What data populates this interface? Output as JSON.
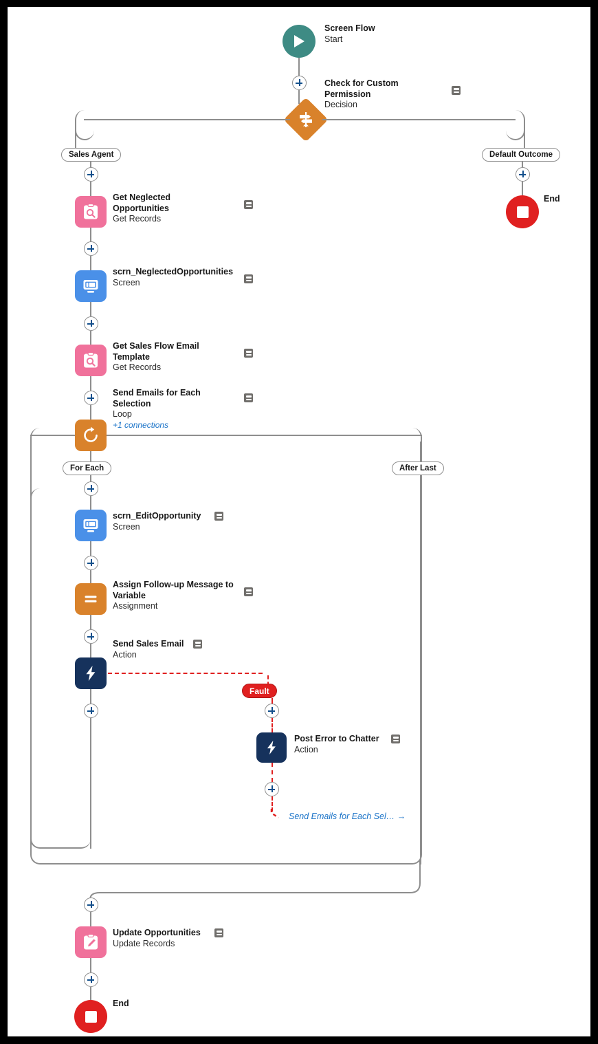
{
  "flow": {
    "start": {
      "title": "Screen Flow",
      "subtitle": "Start",
      "icon": "play-icon"
    },
    "nodes": [
      {
        "id": "decision",
        "title": "Check for Custom Permission",
        "subtitle": "Decision",
        "icon": "signpost-icon"
      },
      {
        "id": "getneg",
        "title": "Get Neglected Opportunities",
        "subtitle": "Get Records",
        "icon": "clipboard-search-icon"
      },
      {
        "id": "scrnneg",
        "title": "scrn_NeglectedOpportunities",
        "subtitle": "Screen",
        "icon": "monitor-icon"
      },
      {
        "id": "gettmpl",
        "title": "Get Sales Flow Email Template",
        "subtitle": "Get Records",
        "icon": "clipboard-search-icon"
      },
      {
        "id": "loop",
        "title": "Send Emails for Each Selection",
        "subtitle": "Loop",
        "icon": "refresh-icon",
        "connections": "+1 connections"
      },
      {
        "id": "scrnedit",
        "title": "scrn_EditOpportunity",
        "subtitle": "Screen",
        "icon": "monitor-icon"
      },
      {
        "id": "assign",
        "title": "Assign Follow-up Message to Variable",
        "subtitle": "Assignment",
        "icon": "equals-icon"
      },
      {
        "id": "sendemail",
        "title": "Send Sales Email",
        "subtitle": "Action",
        "icon": "lightning-icon"
      },
      {
        "id": "posterror",
        "title": "Post Error to Chatter",
        "subtitle": "Action",
        "icon": "lightning-icon"
      },
      {
        "id": "updateopps",
        "title": "Update Opportunities",
        "subtitle": "Update Records",
        "icon": "clipboard-pencil-icon"
      }
    ],
    "branch_labels": {
      "sales_agent": "Sales Agent",
      "default_outcome": "Default Outcome",
      "for_each": "For Each",
      "after_last": "After Last",
      "fault": "Fault"
    },
    "ends": {
      "right_end": "End",
      "bottom_end": "End"
    },
    "goto": {
      "label": "Send Emails for Each Sel…",
      "arrow": "→"
    },
    "colors": {
      "start": "#3E8B84",
      "end": "#E02020",
      "get_records": "#F0719B",
      "screen": "#4A90E8",
      "decision": "#D9822B",
      "loop": "#D9822B",
      "assignment": "#D9822B",
      "action": "#16325C",
      "fault": "#E02020",
      "connector": "#8E8E8E",
      "link": "#1A73C8"
    }
  }
}
